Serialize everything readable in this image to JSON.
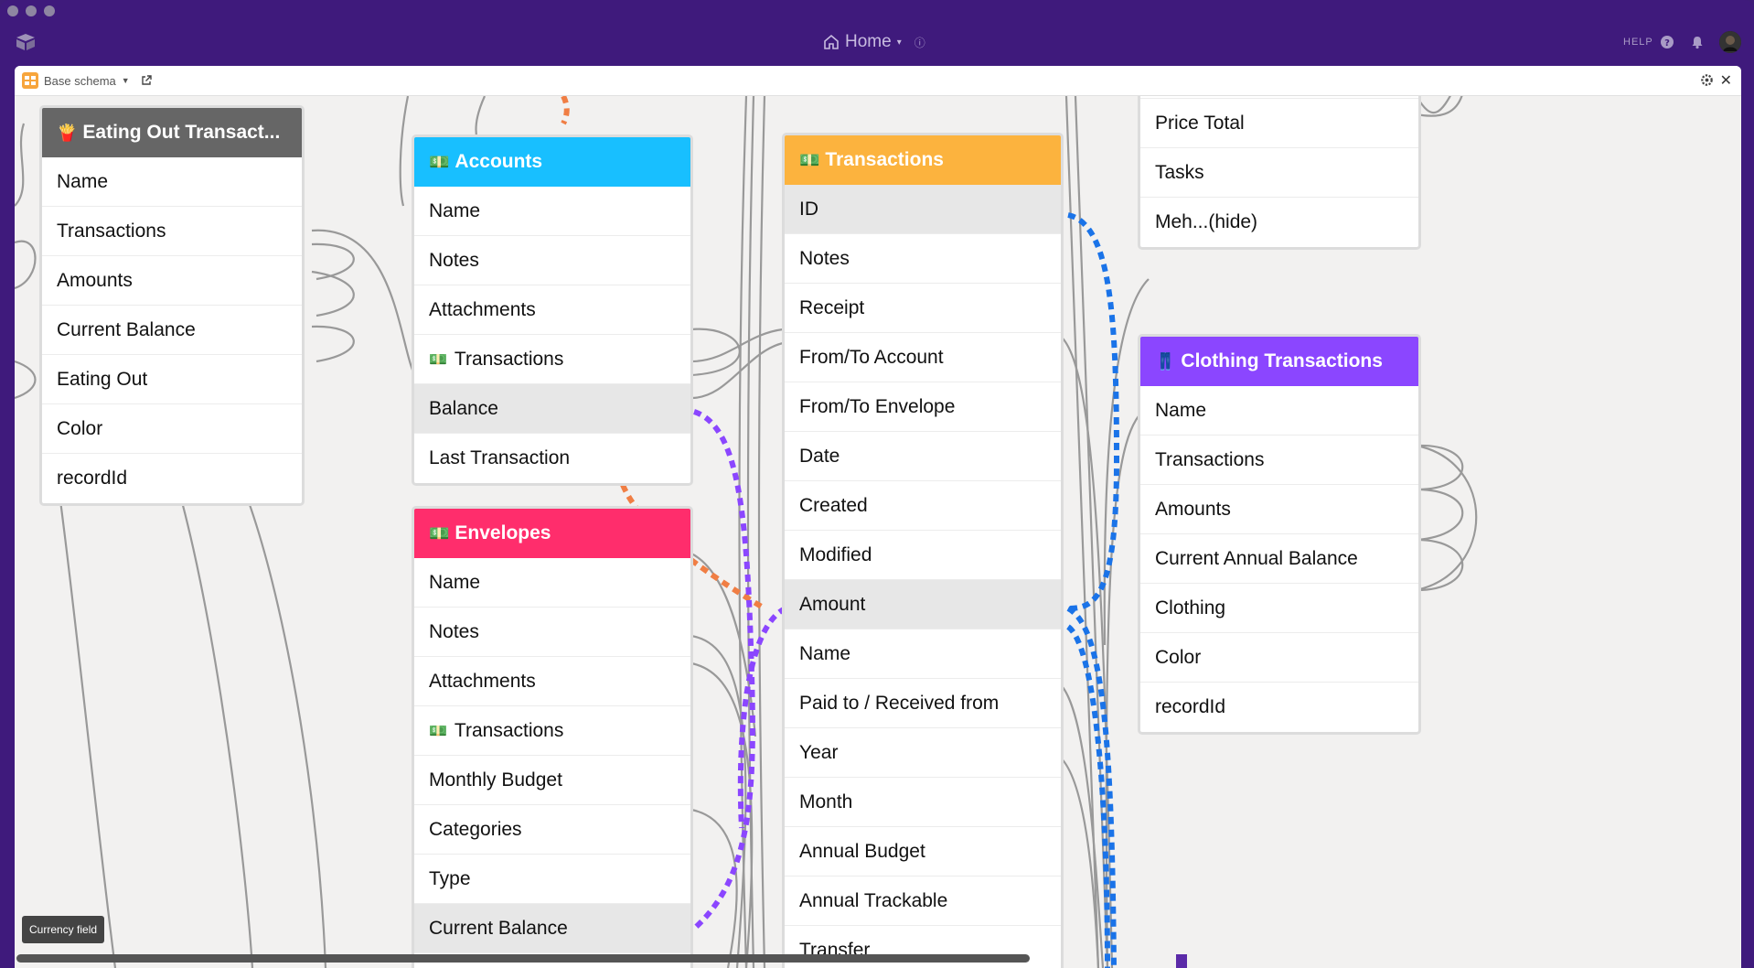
{
  "window": {
    "title": "Home",
    "help_label": "HELP",
    "icons": [
      "app-logo-icon",
      "home-icon",
      "info-icon",
      "help-icon",
      "bell-icon",
      "avatar"
    ]
  },
  "panel": {
    "title": "Base schema",
    "icons": [
      "schema-icon",
      "open-external-icon",
      "settings-icon",
      "close-icon"
    ]
  },
  "tooltip": "Currency field",
  "tables": [
    {
      "key": "eating-out",
      "title": "Eating Out Transact...",
      "emoji": "🍟",
      "color": "#666666",
      "fields": [
        {
          "label": "Name"
        },
        {
          "label": "Transactions"
        },
        {
          "label": "Amounts"
        },
        {
          "label": "Current Balance"
        },
        {
          "label": "Eating Out"
        },
        {
          "label": "Color"
        },
        {
          "label": "recordId"
        }
      ]
    },
    {
      "key": "accounts",
      "title": "Accounts",
      "emoji": "💵",
      "color": "#18bfff",
      "fields": [
        {
          "label": "Name"
        },
        {
          "label": "Notes"
        },
        {
          "label": "Attachments"
        },
        {
          "label": "Transactions",
          "emoji": "💵"
        },
        {
          "label": "Balance",
          "highlight": true
        },
        {
          "label": "Last Transaction"
        }
      ]
    },
    {
      "key": "envelopes",
      "title": "Envelopes",
      "emoji": "💵",
      "color": "#ff2d6c",
      "fields": [
        {
          "label": "Name"
        },
        {
          "label": "Notes"
        },
        {
          "label": "Attachments"
        },
        {
          "label": "Transactions",
          "emoji": "💵"
        },
        {
          "label": "Monthly Budget"
        },
        {
          "label": "Categories"
        },
        {
          "label": "Type"
        },
        {
          "label": "Current Balance",
          "highlight": true
        }
      ]
    },
    {
      "key": "transactions",
      "title": "Transactions",
      "emoji": "💵",
      "color": "#fcb33e",
      "fields": [
        {
          "label": "ID",
          "highlight": true
        },
        {
          "label": "Notes"
        },
        {
          "label": "Receipt"
        },
        {
          "label": "From/To Account"
        },
        {
          "label": "From/To Envelope"
        },
        {
          "label": "Date"
        },
        {
          "label": "Created"
        },
        {
          "label": "Modified"
        },
        {
          "label": "Amount",
          "highlight": true
        },
        {
          "label": "Name"
        },
        {
          "label": "Paid to / Received from"
        },
        {
          "label": "Year"
        },
        {
          "label": "Month"
        },
        {
          "label": "Annual Budget"
        },
        {
          "label": "Annual Trackable"
        },
        {
          "label": "Transfer"
        }
      ]
    },
    {
      "key": "partial",
      "title": "",
      "emoji": "",
      "color": "#ffffff",
      "fields": [
        {
          "label": "Price Total"
        },
        {
          "label": "Tasks"
        },
        {
          "label": "Meh...(hide)"
        }
      ]
    },
    {
      "key": "clothing",
      "title": "Clothing Transactions",
      "emoji": "👖",
      "color": "#8b46ff",
      "fields": [
        {
          "label": "Name"
        },
        {
          "label": "Transactions"
        },
        {
          "label": "Amounts"
        },
        {
          "label": "Current Annual Balance"
        },
        {
          "label": "Clothing"
        },
        {
          "label": "Color"
        },
        {
          "label": "recordId"
        }
      ]
    }
  ]
}
